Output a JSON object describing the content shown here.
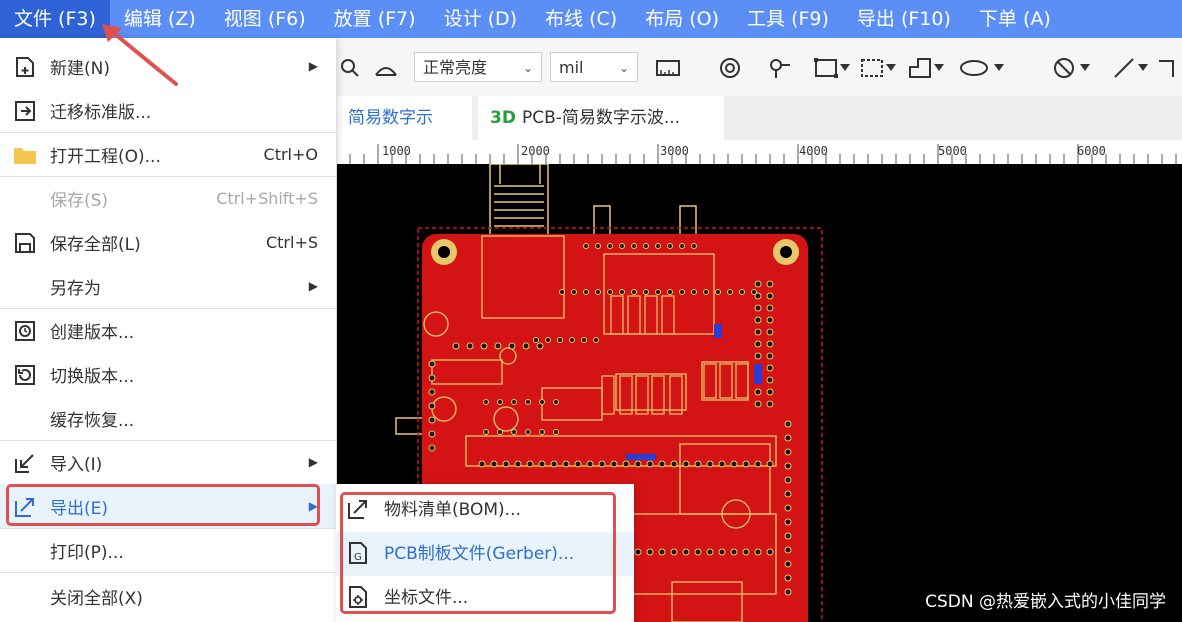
{
  "menubar": {
    "items": [
      {
        "label": "文件 (F3)"
      },
      {
        "label": "编辑 (Z)"
      },
      {
        "label": "视图 (F6)"
      },
      {
        "label": "放置 (F7)"
      },
      {
        "label": "设计 (D)"
      },
      {
        "label": "布线 (C)"
      },
      {
        "label": "布局 (O)"
      },
      {
        "label": "工具 (F9)"
      },
      {
        "label": "导出 (F10)"
      },
      {
        "label": "下单 (A)"
      }
    ]
  },
  "toolbar": {
    "brightness": "正常亮度",
    "unit": "mil"
  },
  "tabs": [
    {
      "label": "简易数字示波..."
    },
    {
      "prefix": "3D",
      "label": "PCB-简易数字示波..."
    }
  ],
  "ruler": {
    "labels": [
      "1000",
      "2000",
      "3000",
      "4000",
      "5000",
      "6000"
    ]
  },
  "file_menu": {
    "items": [
      {
        "label": "新建(N)",
        "shortcut": "",
        "icon": "new-file-icon"
      },
      {
        "label": "迁移标准版...",
        "shortcut": "",
        "icon": "migrate-icon"
      },
      {
        "label": "打开工程(O)...",
        "shortcut": "Ctrl+O",
        "icon": "folder-icon"
      },
      {
        "label": "保存(S)",
        "shortcut": "Ctrl+Shift+S",
        "icon": ""
      },
      {
        "label": "保存全部(L)",
        "shortcut": "Ctrl+S",
        "icon": "save-all-icon"
      },
      {
        "label": "另存为",
        "shortcut": "",
        "icon": ""
      },
      {
        "label": "创建版本...",
        "shortcut": "",
        "icon": "create-version-icon"
      },
      {
        "label": "切换版本...",
        "shortcut": "",
        "icon": "switch-version-icon"
      },
      {
        "label": "缓存恢复...",
        "shortcut": "",
        "icon": ""
      },
      {
        "label": "导入(I)",
        "shortcut": "",
        "icon": "import-icon"
      },
      {
        "label": "导出(E)",
        "shortcut": "",
        "icon": "export-icon"
      },
      {
        "label": "打印(P)...",
        "shortcut": "",
        "icon": ""
      },
      {
        "label": "关闭全部(X)",
        "shortcut": "",
        "icon": ""
      }
    ]
  },
  "export_submenu": {
    "items": [
      {
        "label": "物料清单(BOM)...",
        "icon": "export-arrow-icon"
      },
      {
        "label": "PCB制板文件(Gerber)...",
        "icon": "gerber-file-icon"
      },
      {
        "label": "坐标文件...",
        "icon": "coordinate-file-icon"
      }
    ]
  },
  "watermark": "CSDN @热爱嵌入式的小佳同学",
  "colors": {
    "menubar": "#5b8ff5",
    "menubar_active": "#2f62d6",
    "highlight": "#e8f3fc",
    "annotation_red": "#e05050",
    "board_red": "#d41414",
    "silkscreen": "#e6c86a"
  }
}
